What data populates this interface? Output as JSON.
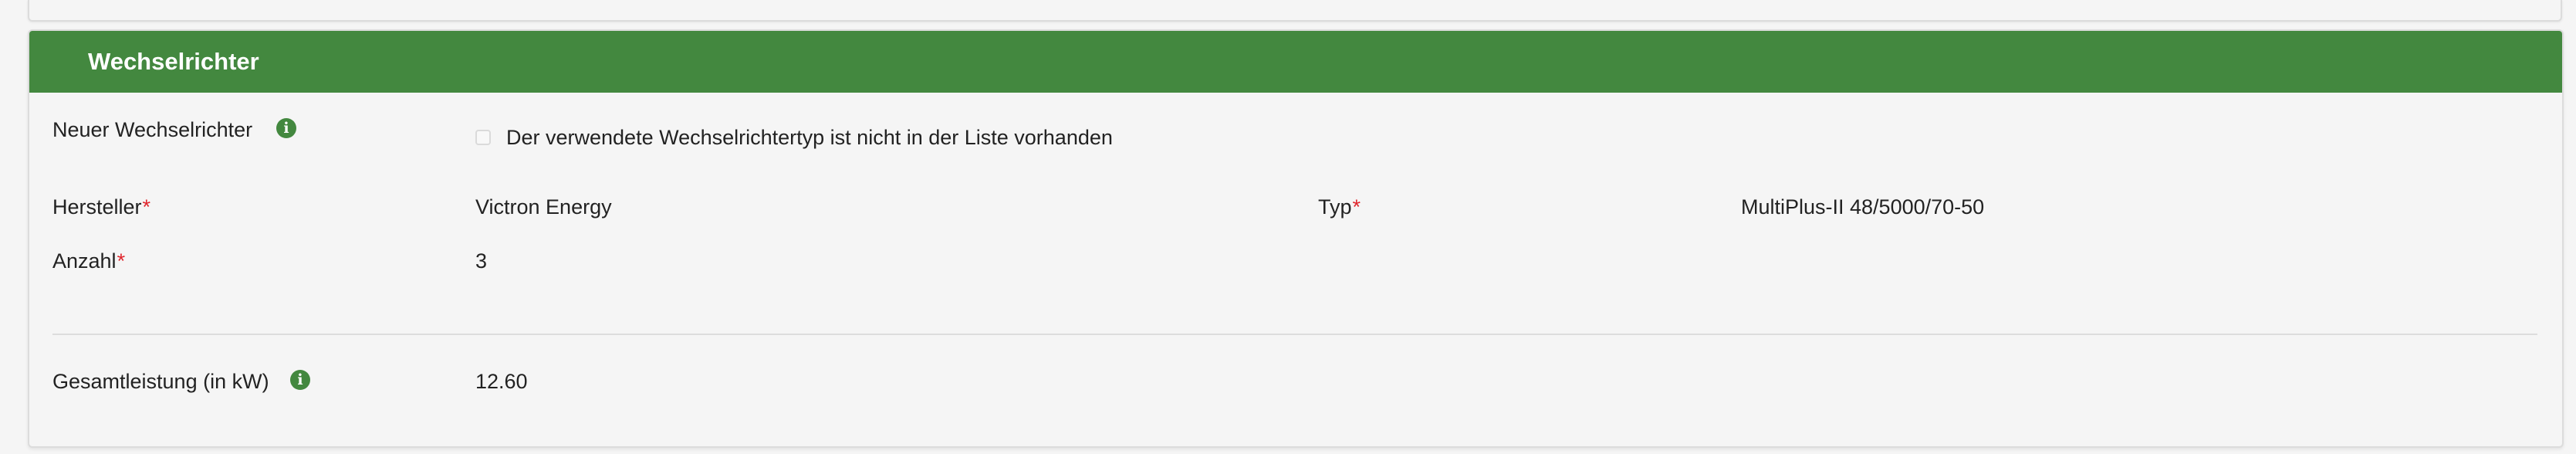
{
  "section": {
    "title": "Wechselrichter"
  },
  "new_inverter": {
    "label": "Neuer Wechselrichter",
    "info_icon": "info-icon",
    "checkbox_label": "Der verwendete Wechselrichtertyp ist nicht in der Liste vorhanden",
    "checked": false
  },
  "fields": {
    "manufacturer": {
      "label": "Hersteller",
      "required_mark": "*",
      "value": "Victron Energy"
    },
    "type": {
      "label": "Typ",
      "required_mark": "*",
      "value": "MultiPlus-II 48/5000/70-50"
    },
    "count": {
      "label": "Anzahl",
      "required_mark": "*",
      "value": "3"
    }
  },
  "total_power": {
    "label": "Gesamtleistung (in kW)",
    "info_icon": "info-icon",
    "value": "12.60"
  },
  "colors": {
    "header_green": "#43883f",
    "required_red": "#e0262d",
    "background": "#f5f5f5"
  }
}
